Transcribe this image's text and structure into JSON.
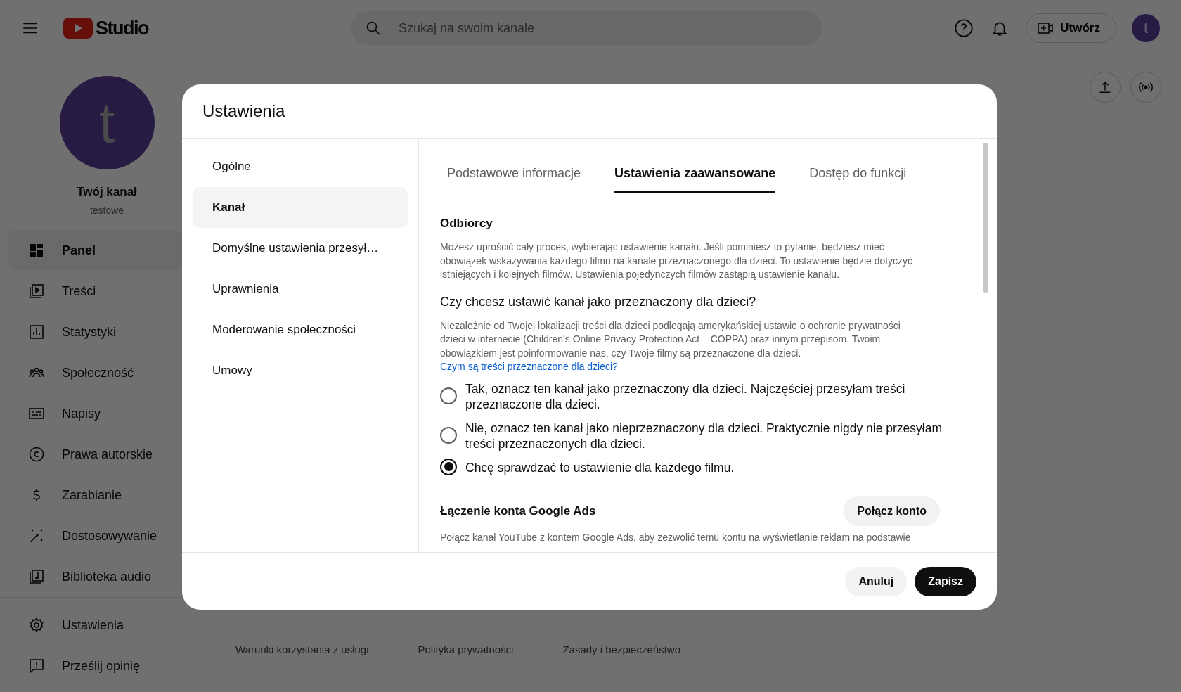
{
  "topbar": {
    "logo": "Studio",
    "search": {
      "placeholder": "Szukaj na swoim kanale"
    },
    "create_button": "Utwórz",
    "avatar": "t"
  },
  "channel": {
    "avatar": "t",
    "name": "Twój kanał",
    "handle": "testowe"
  },
  "sidebar": {
    "items": [
      {
        "kind": "dashboard",
        "label": "Panel",
        "selected": true
      },
      {
        "kind": "content",
        "label": "Treści",
        "selected": false
      },
      {
        "kind": "analytics",
        "label": "Statystyki",
        "selected": false
      },
      {
        "kind": "community",
        "label": "Społeczność",
        "selected": false
      },
      {
        "kind": "subtitles",
        "label": "Napisy",
        "selected": false
      },
      {
        "kind": "copyright",
        "label": "Prawa autorskie",
        "selected": false
      },
      {
        "kind": "earn",
        "label": "Zarabianie",
        "selected": false
      },
      {
        "kind": "customize",
        "label": "Dostosowywanie",
        "selected": false
      },
      {
        "kind": "audio",
        "label": "Biblioteka audio",
        "selected": false
      }
    ],
    "bottom_items": [
      {
        "kind": "settings",
        "label": "Ustawienia",
        "selected": false
      },
      {
        "kind": "feedback",
        "label": "Prześlij opinię",
        "selected": false
      }
    ]
  },
  "footer_links": [
    "Warunki korzystania z usługi",
    "Polityka prywatności",
    "Zasady i bezpieczeństwo"
  ],
  "dialog": {
    "title": "Ustawienia",
    "nav": [
      {
        "label": "Ogólne",
        "selected": false
      },
      {
        "label": "Kanał",
        "selected": true
      },
      {
        "label": "Domyślne ustawienia przesył…",
        "selected": false
      },
      {
        "label": "Uprawnienia",
        "selected": false
      },
      {
        "label": "Moderowanie społeczności",
        "selected": false
      },
      {
        "label": "Umowy",
        "selected": false
      }
    ],
    "tabs": [
      {
        "label": "Podstawowe informacje",
        "selected": false
      },
      {
        "label": "Ustawienia zaawansowane",
        "selected": true
      },
      {
        "label": "Dostęp do funkcji",
        "selected": false
      }
    ],
    "audience": {
      "heading": "Odbiorcy",
      "description": "Możesz uprościć cały proces, wybierając ustawienie kanału. Jeśli pominiesz to pytanie, będziesz mieć obowiązek wskazywania każdego filmu na kanale przeznaczonego dla dzieci. To ustawienie będzie dotyczyć istniejących i kolejnych filmów. Ustawienia pojedynczych filmów zastąpią ustawienie kanału.",
      "question": "Czy chcesz ustawić kanał jako przeznaczony dla dzieci?",
      "note": "Niezależnie od Twojej lokalizacji treści dla dzieci podlegają amerykańskiej ustawie o ochronie prywatności dzieci w internecie (Children's Online Privacy Protection Act – COPPA) oraz innym przepisom. Twoim obowiązkiem jest poinformowanie nas, czy Twoje filmy są przeznaczone dla dzieci.",
      "note_link": "Czym są treści przeznaczone dla dzieci?",
      "options": [
        {
          "label": "Tak, oznacz ten kanał jako przeznaczony dla dzieci. Najczęściej przesyłam treści przeznaczone dla dzieci.",
          "selected": false
        },
        {
          "label": "Nie, oznacz ten kanał jako nieprzeznaczony dla dzieci. Praktycznie nigdy nie przesyłam treści przeznaczonych dla dzieci.",
          "selected": false
        },
        {
          "label": "Chcę sprawdzać to ustawienie dla każdego filmu.",
          "selected": true
        }
      ]
    },
    "google_ads": {
      "heading": "Łączenie konta Google Ads",
      "button": "Połącz konto",
      "description": "Połącz kanał YouTube z kontem Google Ads, aby zezwolić temu kontu na wyświetlanie reklam na podstawie"
    },
    "buttons": {
      "cancel": "Anuluj",
      "save": "Zapisz"
    }
  }
}
